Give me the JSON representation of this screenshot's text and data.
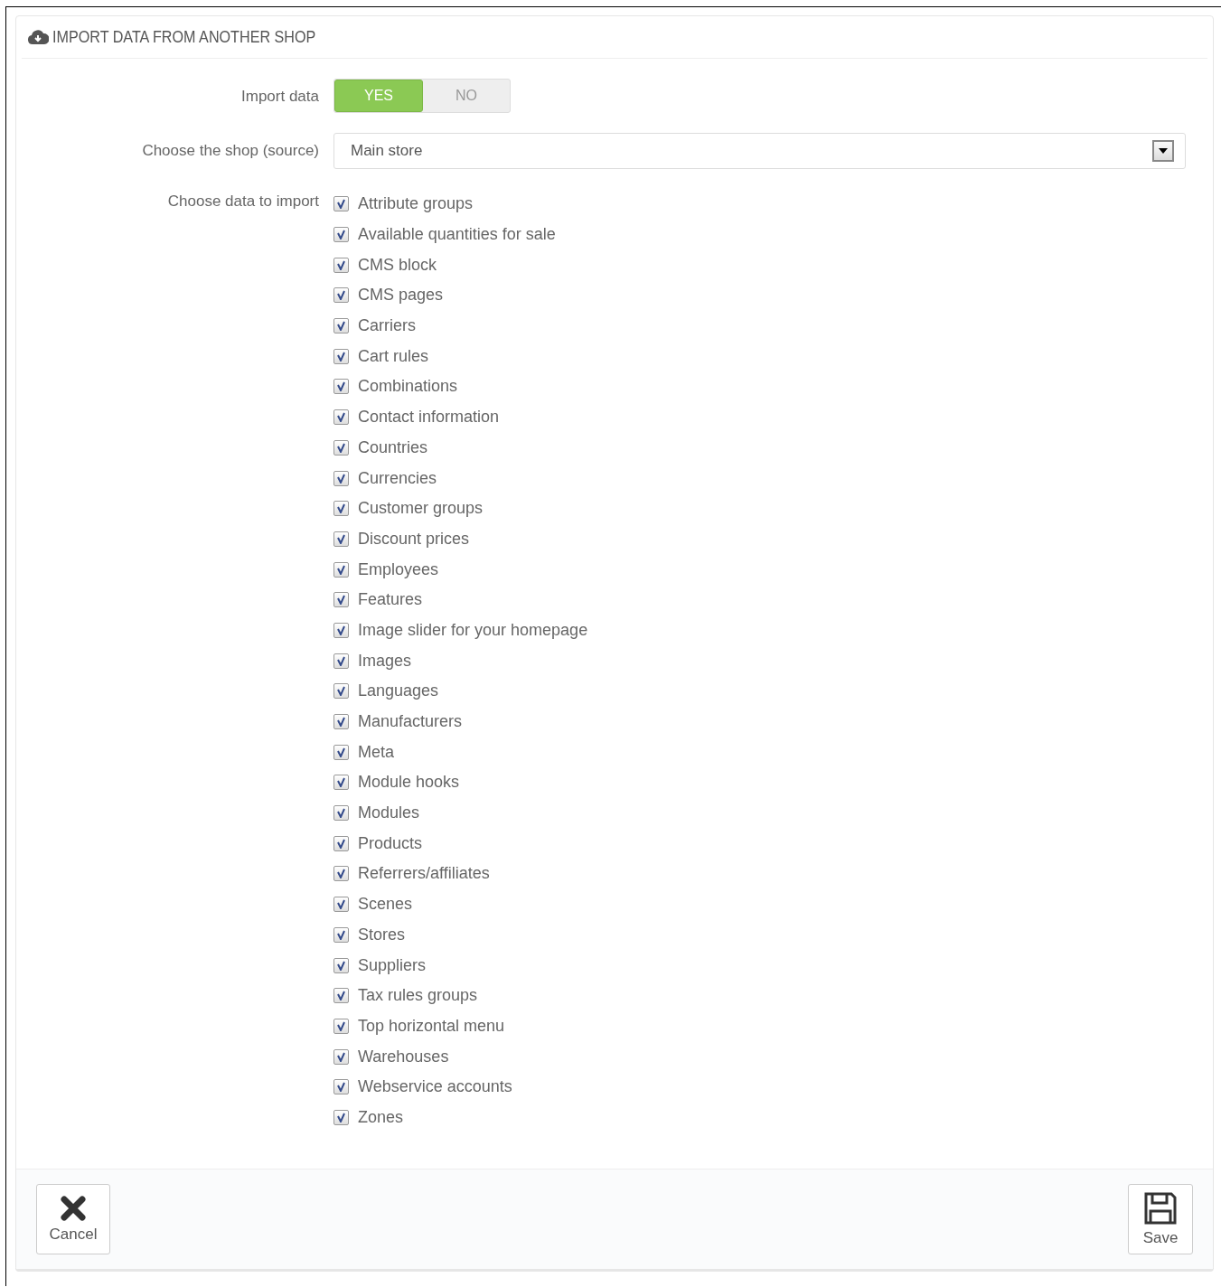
{
  "panel": {
    "title": "IMPORT DATA FROM ANOTHER SHOP"
  },
  "import_data": {
    "label": "Import data",
    "options": [
      {
        "label": "YES",
        "selected": true
      },
      {
        "label": "NO",
        "selected": false
      }
    ]
  },
  "shop": {
    "label": "Choose the shop (source)",
    "value": "Main store"
  },
  "data_to_import": {
    "label": "Choose data to import",
    "items": [
      {
        "label": "Attribute groups",
        "checked": true
      },
      {
        "label": "Available quantities for sale",
        "checked": true
      },
      {
        "label": "CMS block",
        "checked": true
      },
      {
        "label": "CMS pages",
        "checked": true
      },
      {
        "label": "Carriers",
        "checked": true
      },
      {
        "label": "Cart rules",
        "checked": true
      },
      {
        "label": "Combinations",
        "checked": true
      },
      {
        "label": "Contact information",
        "checked": true
      },
      {
        "label": "Countries",
        "checked": true
      },
      {
        "label": "Currencies",
        "checked": true
      },
      {
        "label": "Customer groups",
        "checked": true
      },
      {
        "label": "Discount prices",
        "checked": true
      },
      {
        "label": "Employees",
        "checked": true
      },
      {
        "label": "Features",
        "checked": true
      },
      {
        "label": "Image slider for your homepage",
        "checked": true
      },
      {
        "label": "Images",
        "checked": true
      },
      {
        "label": "Languages",
        "checked": true
      },
      {
        "label": "Manufacturers",
        "checked": true
      },
      {
        "label": "Meta",
        "checked": true
      },
      {
        "label": "Module hooks",
        "checked": true
      },
      {
        "label": "Modules",
        "checked": true
      },
      {
        "label": "Products",
        "checked": true
      },
      {
        "label": "Referrers/affiliates",
        "checked": true
      },
      {
        "label": "Scenes",
        "checked": true
      },
      {
        "label": "Stores",
        "checked": true
      },
      {
        "label": "Suppliers",
        "checked": true
      },
      {
        "label": "Tax rules groups",
        "checked": true
      },
      {
        "label": "Top horizontal menu",
        "checked": true
      },
      {
        "label": "Warehouses",
        "checked": true
      },
      {
        "label": "Webservice accounts",
        "checked": true
      },
      {
        "label": "Zones",
        "checked": true
      }
    ]
  },
  "footer": {
    "buttons": [
      {
        "kind": "cancel",
        "label": "Cancel"
      },
      {
        "kind": "save",
        "label": "Save"
      }
    ]
  }
}
